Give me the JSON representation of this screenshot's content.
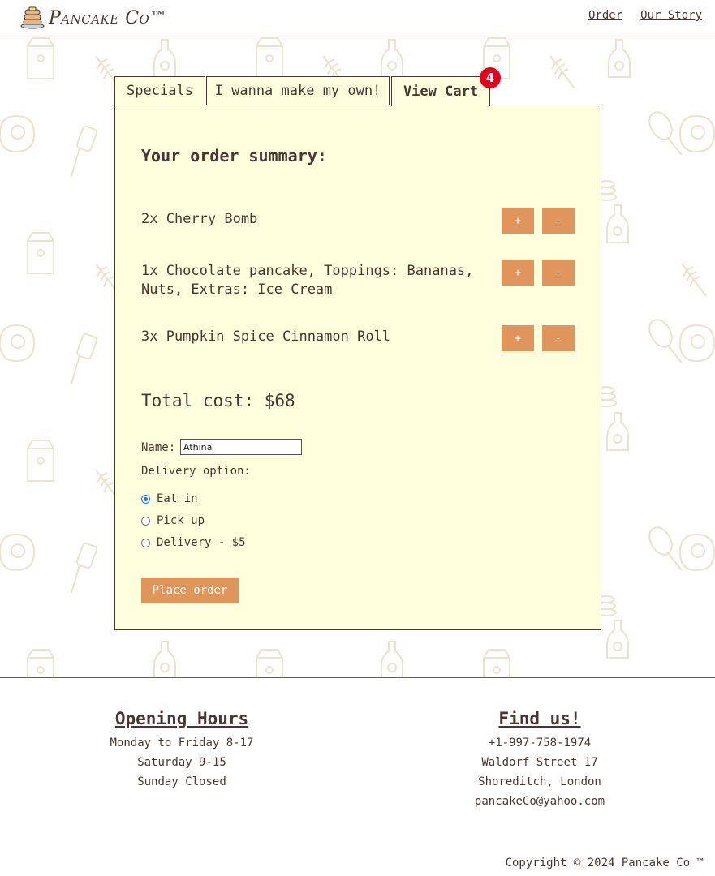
{
  "header": {
    "brand": "Pancake Co™",
    "nav": [
      {
        "label": "Order"
      },
      {
        "label": "Our Story"
      }
    ]
  },
  "tabs": [
    {
      "label": "Specials"
    },
    {
      "label": "I wanna make my own!"
    },
    {
      "label": "View Cart",
      "active": true
    }
  ],
  "cart_badge": "4",
  "order": {
    "heading": "Your order summary:",
    "items": [
      {
        "text": "2x Cherry Bomb"
      },
      {
        "text": "1x Chocolate pancake, Toppings: Bananas, Nuts, Extras: Ice Cream"
      },
      {
        "text": "3x Pumpkin Spice Cinnamon Roll"
      }
    ],
    "plus_label": "+",
    "minus_label": "-",
    "total": "Total cost: $68"
  },
  "form": {
    "name_label": "Name:",
    "name_value": "Athina",
    "delivery_label": "Delivery option:",
    "options": [
      {
        "label": "Eat in",
        "checked": true
      },
      {
        "label": "Pick up",
        "checked": false
      },
      {
        "label": "Delivery - $5",
        "checked": false
      }
    ],
    "submit_label": "Place order"
  },
  "footer": {
    "hours_title": "Opening Hours",
    "hours": [
      "Monday to Friday 8-17",
      "Saturday 9-15",
      "Sunday Closed"
    ],
    "find_title": "Find us!",
    "contact": [
      "+1-997-758-1974",
      "Waldorf Street 17",
      "Shoreditch, London",
      "pancakeCo@yahoo.com"
    ],
    "copyright": "Copyright © 2024 Pancake Co ™"
  },
  "colors": {
    "accent": "#df955b",
    "panel": "#fffedd",
    "text": "#4a3630",
    "badge": "#e8001a",
    "pattern": "#ece3cf"
  }
}
